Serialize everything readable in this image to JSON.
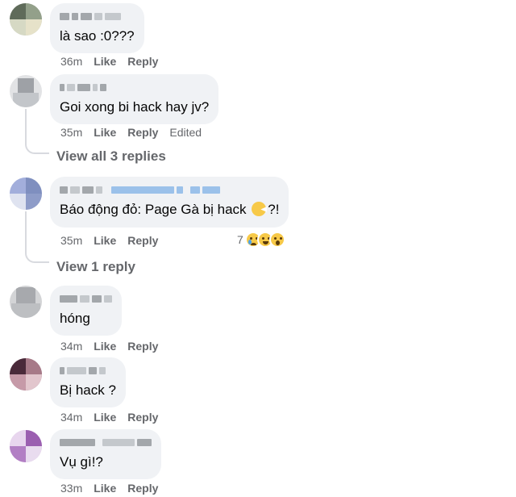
{
  "comments": [
    {
      "text": "là sao :0???",
      "time": "36m",
      "like": "Like",
      "reply": "Reply"
    },
    {
      "text": "Goi xong bi hack hay jv?",
      "time": "35m",
      "like": "Like",
      "reply": "Reply",
      "edited": "Edited",
      "view_replies": "View all 3 replies"
    },
    {
      "text_before": "Báo động đỏ: Page Gà bị hack ",
      "text_after": "?!",
      "time": "35m",
      "like": "Like",
      "reply": "Reply",
      "reaction_count": "7",
      "reactions": [
        "sad-emoji",
        "haha-emoji",
        "wow-emoji"
      ],
      "view_replies": "View 1 reply"
    },
    {
      "text": "hóng",
      "time": "34m",
      "like": "Like",
      "reply": "Reply"
    },
    {
      "text": "Bị hack ?",
      "time": "34m",
      "like": "Like",
      "reply": "Reply"
    },
    {
      "text": "Vụ gì!?",
      "time": "33m",
      "like": "Like",
      "reply": "Reply"
    }
  ],
  "colors": {
    "bubble": "#f0f2f5",
    "meta": "#65676b",
    "text": "#050505"
  }
}
